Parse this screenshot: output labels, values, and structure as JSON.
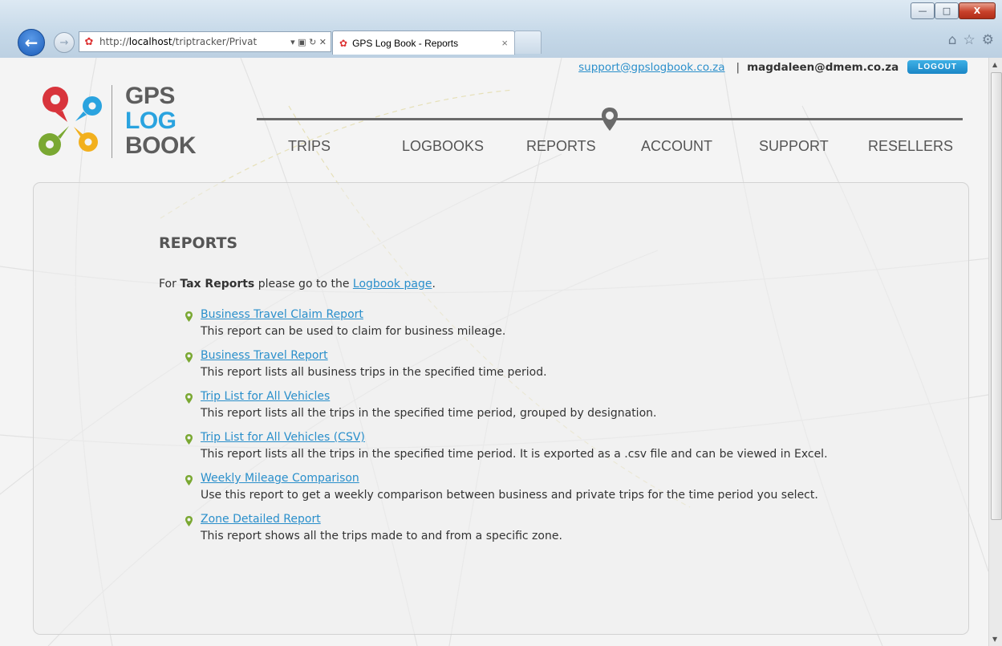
{
  "browser": {
    "address": {
      "url_prefix": "http://",
      "url_host": "localhost",
      "url_rest": "/triptracker/Privat",
      "controls": "▾ ▣ ↻ ✕"
    },
    "tab": {
      "title": "GPS Log Book - Reports",
      "close": "×"
    },
    "window_buttons": {
      "minimize": "—",
      "maximize": "□",
      "close": "X"
    }
  },
  "header": {
    "support_email": "support@gpslogbook.co.za",
    "separator": "|",
    "user_email": "magdaleen@dmem.co.za",
    "logout_label": "LOGOUT"
  },
  "logo": {
    "line1": "GPS",
    "line2": "LOG",
    "line3": "BOOK"
  },
  "nav": {
    "items": [
      {
        "label": "TRIPS"
      },
      {
        "label": "LOGBOOKS"
      },
      {
        "label": "REPORTS"
      },
      {
        "label": "ACCOUNT"
      },
      {
        "label": "SUPPORT"
      },
      {
        "label": "RESELLERS"
      }
    ]
  },
  "main": {
    "title": "REPORTS",
    "intro_prefix": "For ",
    "intro_bold": "Tax Reports",
    "intro_middle": " please go to the ",
    "intro_link": "Logbook page",
    "intro_suffix": ".",
    "reports": [
      {
        "name": "Business Travel Claim Report",
        "description": "This report can be used to claim for business mileage."
      },
      {
        "name": "Business Travel Report",
        "description": "This report lists all business trips in the specified time period."
      },
      {
        "name": "Trip List for All Vehicles",
        "description": "This report lists all the trips in the specified time period, grouped by designation."
      },
      {
        "name": "Trip List for All Vehicles (CSV)",
        "description": "This report lists all the trips in the specified time period. It is exported as a .csv file and can be viewed in Excel."
      },
      {
        "name": "Weekly Mileage Comparison",
        "description": "Use this report to get a weekly comparison between business and private trips for the time period you select."
      },
      {
        "name": "Zone Detailed Report",
        "description": "This report shows all the trips made to and from a specific zone."
      }
    ]
  },
  "colors": {
    "link": "#2a8fcb",
    "pin": "#7aa832",
    "logout_bg": "#2a9ad8",
    "nav_text": "#555555"
  }
}
